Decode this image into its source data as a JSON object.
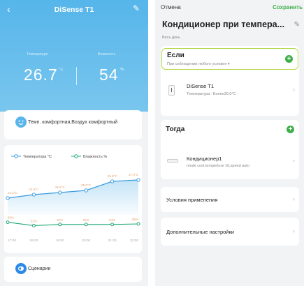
{
  "left": {
    "title": "DiSense T1",
    "temp_label": "Температура",
    "temp_value": "26.7",
    "temp_unit": "°C",
    "hum_label": "Влажность",
    "hum_value": "54",
    "hum_unit": "%",
    "comfort_text": "Темп. комфортная,Воздух комфортный",
    "scenario_label": "Сценарии"
  },
  "chart_data": {
    "type": "line",
    "categories": [
      "17:00",
      "18:00",
      "19:00",
      "20:00",
      "21:00",
      "22:00"
    ],
    "series": [
      {
        "name": "Температура °C",
        "values": [
          24.4,
          24.9,
          25.2,
          25.5,
          26.8,
          27.0
        ],
        "labels": [
          "24.4°C",
          "24.9°C",
          "25.2°C",
          "25.5°C",
          "26.8°C",
          "27.0°C"
        ]
      },
      {
        "name": "Влажность %",
        "values": [
          58,
          52,
          54,
          54,
          54,
          55
        ],
        "labels": [
          "58%",
          "52%",
          "54%",
          "54%",
          "54%",
          "55%"
        ]
      }
    ],
    "colors": {
      "temperature": "#3a9be0",
      "humidity": "#1fa874"
    }
  },
  "right": {
    "cancel": "Отмена",
    "save": "Сохранить",
    "title": "Кондиционер при темпера...",
    "schedule": "Весь день",
    "if_title": "Если",
    "if_sub": "При соблюдении любого условия",
    "device_name": "DiSense T1",
    "device_cond": "Температура : Более30.0°C",
    "then_title": "Тогда",
    "action_name": "Кондиционер1",
    "action_detail": "mode cool,temperture 16,speed auto",
    "conditions": "Условия применения",
    "extra": "Дополнительные настройки"
  },
  "colors": {
    "accent_green": "#3fae49",
    "header_blue": "#56b5ea",
    "highlight_border": "#b5d94f"
  }
}
